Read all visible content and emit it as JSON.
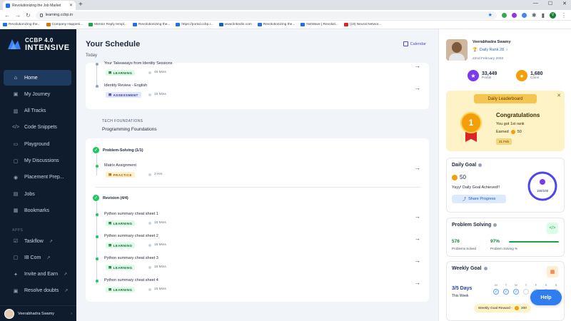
{
  "browser": {
    "tab_title": "Revolutionizing the Job Market",
    "url": "learning.ccbp.in",
    "profile_initial": "V",
    "bookmarks": [
      {
        "label": "Revolutionizing the...",
        "color": "#1a73e8"
      },
      {
        "label": "Company Happeni...",
        "color": "#d97706"
      },
      {
        "label": "Mentor Reply templ...",
        "color": "#16a34a"
      },
      {
        "label": "Revolutionizing the...",
        "color": "#1a73e8"
      },
      {
        "label": "https://portal.ccbp.i...",
        "color": "#1a73e8"
      },
      {
        "label": "www.linkedin.com",
        "color": "#0a66c2"
      },
      {
        "label": "Revolutionizing the...",
        "color": "#1a73e8"
      },
      {
        "label": "NxtWave | Revoluti...",
        "color": "#1a73e8"
      },
      {
        "label": "(19) Neural Networ...",
        "color": "#dc2626"
      }
    ]
  },
  "brand": {
    "line1": "CCBP 4.0",
    "line2": "INTENSIVE"
  },
  "sidebar": {
    "items": [
      {
        "label": "Home",
        "icon": "home-icon"
      },
      {
        "label": "My Journey",
        "icon": "journey-icon"
      },
      {
        "label": "All Tracks",
        "icon": "tracks-icon"
      },
      {
        "label": "Code Snippets",
        "icon": "code-icon"
      },
      {
        "label": "Playground",
        "icon": "playground-icon"
      },
      {
        "label": "My Discussions",
        "icon": "chat-icon"
      },
      {
        "label": "Placement Prep...",
        "icon": "placement-icon"
      },
      {
        "label": "Jobs",
        "icon": "jobs-icon"
      },
      {
        "label": "Bookmarks",
        "icon": "bookmark-icon"
      }
    ],
    "apps_label": "APPS",
    "apps": [
      {
        "label": "Taskflow",
        "icon": "check-square-icon"
      },
      {
        "label": "IB Com",
        "icon": "chat-bubble-icon"
      },
      {
        "label": "Invite and Earn",
        "icon": "gift-icon"
      },
      {
        "label": "Resolve doubts",
        "icon": "doubt-icon"
      }
    ],
    "user_name": "Veerabhadra Swamy"
  },
  "main": {
    "title": "Your Schedule",
    "subtitle": "Today",
    "calendar_label": "Calendar",
    "card1": [
      {
        "name": "Your Takeaways from Identity Sessions",
        "tag": "LEARNING",
        "duration": "45 Mins"
      },
      {
        "name": "Identity Review - English",
        "tag": "ASSESSMENT",
        "duration": "15 Mins"
      }
    ],
    "section_label": "TECH FOUNDATIONS",
    "section_title": "Programming Foundations",
    "group1": {
      "title": "Problem-Solving (1/1)",
      "items": [
        {
          "name": "Matrix Assignment",
          "tag": "PRACTICE",
          "duration": "2 Hrs"
        }
      ]
    },
    "group2": {
      "title": "Revision (4/4)",
      "items": [
        {
          "name": "Python summary cheat sheet 1",
          "tag": "LEARNING",
          "duration": "15 Mins"
        },
        {
          "name": "Python summary cheat sheet 2",
          "tag": "LEARNING",
          "duration": "15 Mins"
        },
        {
          "name": "Python summary cheat sheet 3",
          "tag": "LEARNING",
          "duration": "15 Mins"
        },
        {
          "name": "Python summary cheat sheet 4",
          "tag": "LEARNING",
          "duration": "15 Mins"
        }
      ]
    }
  },
  "profile": {
    "name": "Veerabhadra Swamy",
    "rank": "Daily Rank 28",
    "date": "22nd February 2023",
    "points": "33,449",
    "points_label": "Points",
    "coins": "1,680",
    "coins_label": "Coins"
  },
  "leaderboard": {
    "title": "Daily Leaderboard",
    "rank_number": "1",
    "congrats": "Congratulations",
    "got": "You got 1st rank",
    "earned_label": "Earned",
    "earned_value": "50",
    "date_chip": "21 Feb"
  },
  "daily_goal": {
    "title": "Daily Goal",
    "value": "50",
    "message": "Yayy! Daily Goal Achieved!!",
    "share_label": "Share Progress",
    "ring_label": "150/100",
    "progress_fraction": 1.0
  },
  "problem_solving": {
    "title": "Problem Solving",
    "solved": "576",
    "solved_label": "Problems Solved",
    "percent": "97%",
    "percent_label": "Problem Solving %"
  },
  "weekly_goal": {
    "title": "Weekly Goal",
    "days": "3/5 Days",
    "week_label": "This Week",
    "day_letters": [
      "M",
      "T",
      "W",
      "T",
      "F",
      "S",
      "S"
    ],
    "done": [
      true,
      true,
      true,
      false,
      false,
      false,
      false
    ],
    "reward_label": "Weekly Goal Reward -",
    "reward_value": "300"
  },
  "help_label": "Help",
  "colors": {
    "sidebar": "#0f1c2e",
    "accent": "#2e7ef0",
    "success": "#22c55e"
  }
}
